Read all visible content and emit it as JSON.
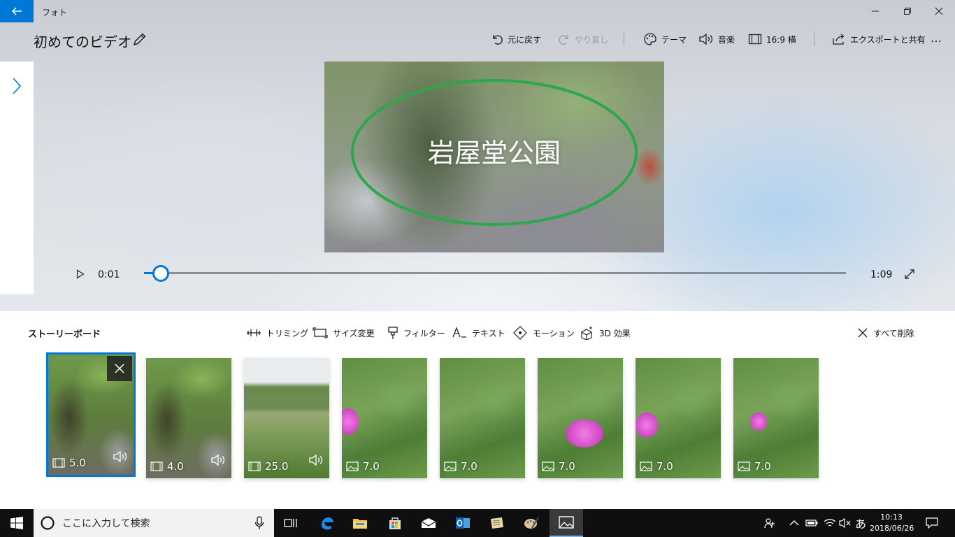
{
  "window": {
    "app_name": "フォト"
  },
  "header": {
    "project_title": "初めてのビデオ"
  },
  "toolbar": {
    "undo": "元に戻す",
    "redo": "やり直し",
    "theme": "テーマ",
    "music": "音楽",
    "aspect": "16:9 横",
    "export": "エクスポートと共有",
    "more": "…"
  },
  "preview": {
    "title_text": "岩屋堂公園",
    "annotation_color": "#2aa84a"
  },
  "playback": {
    "current_time": "0:01",
    "total_time": "1:09",
    "progress_fraction": 0.024
  },
  "storyboard": {
    "label": "ストーリーボード",
    "tools": {
      "trim": "トリミング",
      "resize": "サイズ変更",
      "filter": "フィルター",
      "text": "テキスト",
      "motion": "モーション",
      "effects3d": "3D 効果"
    },
    "delete_all": "すべて削除",
    "clips": [
      {
        "type": "video",
        "duration": "5.0",
        "audio": true,
        "selected": true,
        "scene": "forest"
      },
      {
        "type": "video",
        "duration": "4.0",
        "audio": true,
        "selected": false,
        "scene": "forest"
      },
      {
        "type": "video",
        "duration": "25.0",
        "audio": true,
        "selected": false,
        "scene": "field"
      },
      {
        "type": "image",
        "duration": "7.0",
        "audio": false,
        "selected": false,
        "scene": "flower"
      },
      {
        "type": "image",
        "duration": "7.0",
        "audio": false,
        "selected": false,
        "scene": "flower"
      },
      {
        "type": "image",
        "duration": "7.0",
        "audio": false,
        "selected": false,
        "scene": "flower"
      },
      {
        "type": "image",
        "duration": "7.0",
        "audio": false,
        "selected": false,
        "scene": "flower"
      },
      {
        "type": "image",
        "duration": "7.0",
        "audio": false,
        "selected": false,
        "scene": "flower"
      }
    ]
  },
  "taskbar": {
    "search_placeholder": "ここに入力して検索",
    "ime": "あ",
    "time": "10:13",
    "date": "2018/06/26"
  },
  "colors": {
    "accent": "#0078d7",
    "taskbar": "#0f0f10"
  }
}
